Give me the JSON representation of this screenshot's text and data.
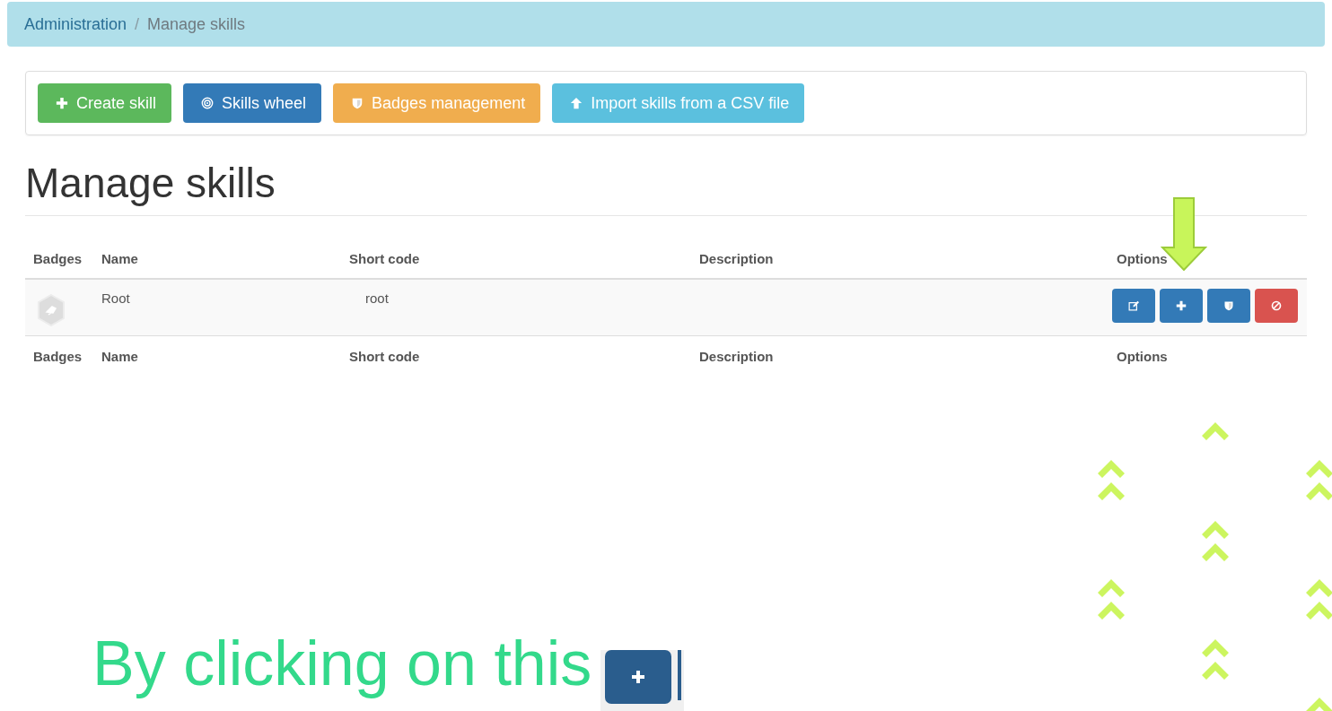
{
  "breadcrumb": [
    {
      "label": "Administration",
      "kind": "link"
    },
    {
      "label": "/",
      "kind": "separator"
    },
    {
      "label": "Manage skills",
      "kind": "current"
    }
  ],
  "toolbar": [
    {
      "label": "Create skill",
      "kind": "create"
    },
    {
      "label": "Skills wheel",
      "kind": "wheel"
    },
    {
      "label": "Badges management",
      "kind": "badges"
    },
    {
      "label": "Import skills from a CSV file",
      "kind": "import"
    }
  ],
  "heading": "Manage skills",
  "table": {
    "columns": [
      "Badges",
      "Name",
      "Short code",
      "Description",
      "Options"
    ],
    "rows": [
      {
        "name": "Root",
        "short_code": "root",
        "options": [
          {
            "kind": "edit"
          },
          {
            "kind": "add"
          },
          {
            "kind": "badge"
          },
          {
            "kind": "delete"
          }
        ]
      }
    ],
    "footer_columns": [
      "Badges",
      "Name",
      "Short code",
      "Description",
      "Options"
    ]
  },
  "caption": "By clicking on this"
}
